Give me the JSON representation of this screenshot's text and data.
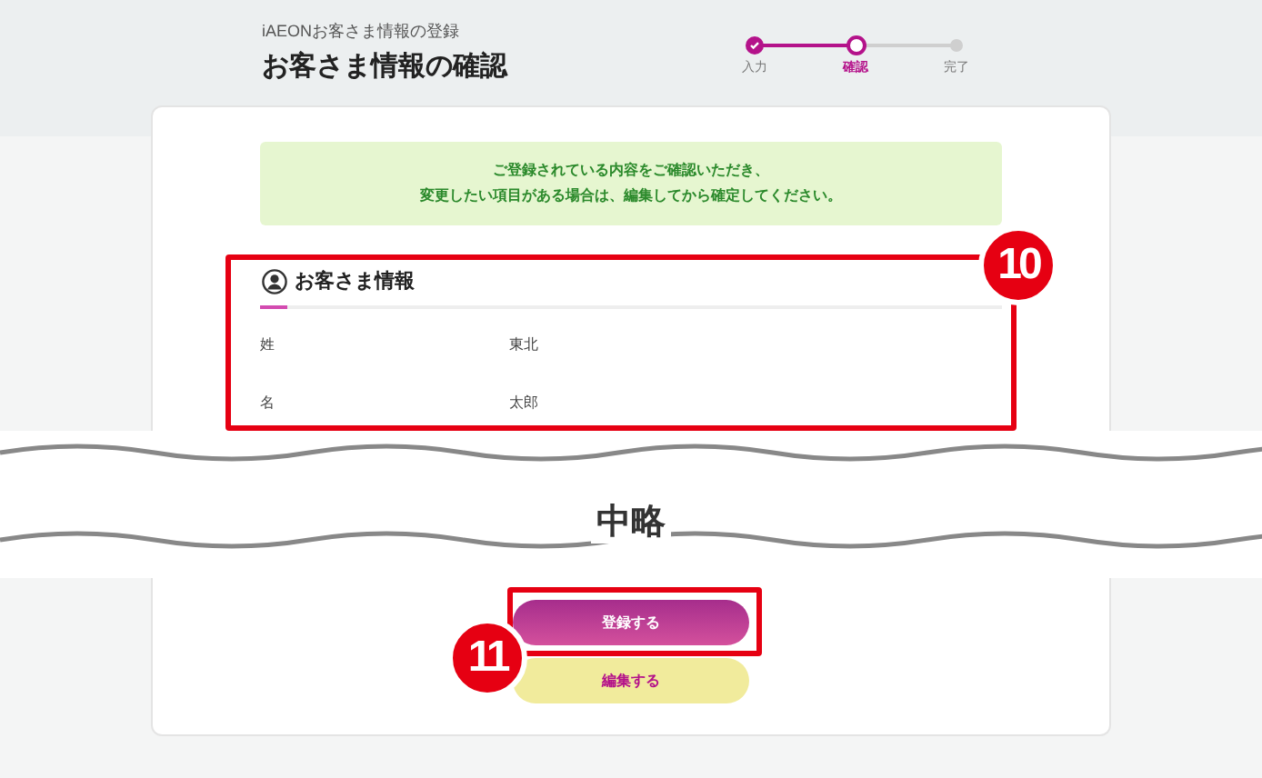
{
  "header": {
    "breadcrumb": "iAEONお客さま情報の登録",
    "title": "お客さま情報の確認"
  },
  "steps": [
    {
      "label": "入力",
      "completed": true,
      "selected": false
    },
    {
      "label": "確認",
      "completed": false,
      "selected": true
    },
    {
      "label": "完了",
      "completed": false,
      "selected": false
    }
  ],
  "notice": [
    "ご登録されている内容をご確認いただき、",
    "変更したい項目がある場合は、編集してから確定してください。"
  ],
  "section": {
    "title": "お客さま情報",
    "fields": [
      {
        "label": "姓",
        "value": "東北"
      },
      {
        "label": "名",
        "value": "太郎"
      }
    ]
  },
  "omission": "中略",
  "buttons": [
    {
      "label": "登録する",
      "kind": "primary"
    },
    {
      "label": "編集する",
      "kind": "secondary"
    }
  ],
  "annotations": [
    {
      "label": "10"
    },
    {
      "label": "11"
    }
  ]
}
